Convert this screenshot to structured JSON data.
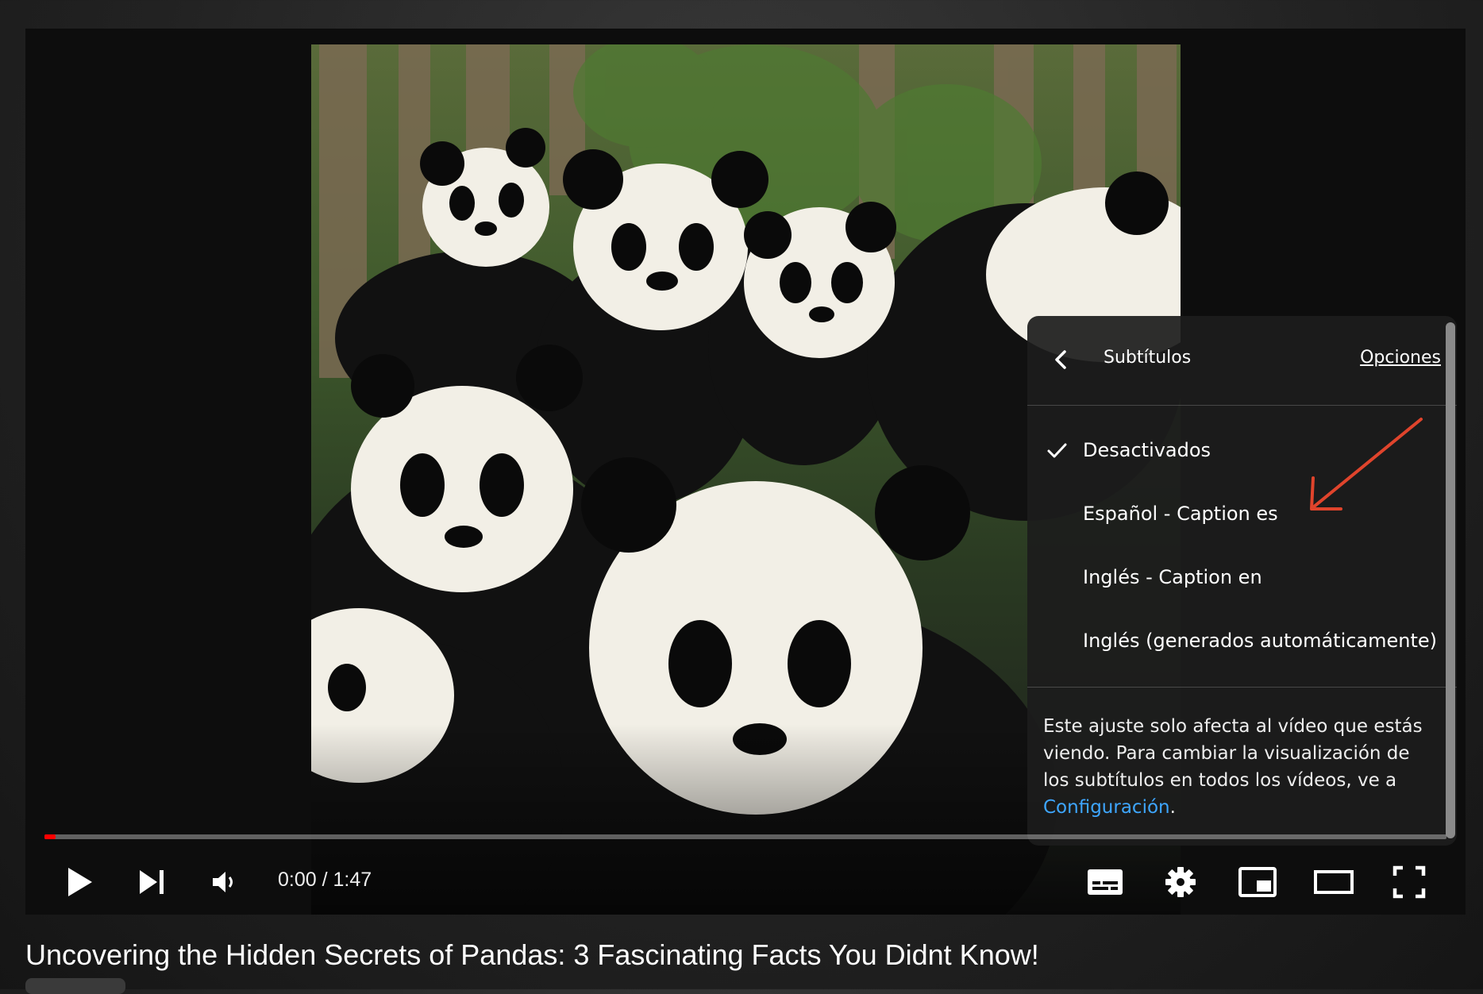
{
  "player": {
    "time_current": "0:00",
    "time_separator": " / ",
    "time_total": "1:47",
    "progress_fraction": 0.008,
    "accent_color": "#ff0000",
    "controls": {
      "play": "play-icon",
      "next": "next-icon",
      "volume": "volume-icon",
      "subtitles": "subtitles-icon",
      "settings": "gear-icon",
      "miniplayer": "miniplayer-icon",
      "theater": "theater-icon",
      "fullscreen": "fullscreen-icon"
    }
  },
  "menu": {
    "title": "Subtítulos",
    "options_link": "Opciones",
    "items": [
      {
        "label": "Desactivados",
        "selected": true
      },
      {
        "label": "Español - Caption es",
        "selected": false
      },
      {
        "label": "Inglés - Caption en",
        "selected": false
      },
      {
        "label": "Inglés (generados automáticamente)",
        "selected": false
      }
    ],
    "note_text": "Este ajuste solo afecta al vídeo que estás viendo. Para cambiar la visualización de los subtítulos en todos los vídeos, ve a ",
    "note_link": "Configuración",
    "note_end": ".",
    "link_color": "#3ea6ff"
  },
  "annotation": {
    "color": "#e0442c"
  },
  "video": {
    "title": "Uncovering the Hidden Secrets of Pandas: 3 Fascinating Facts You Didnt Know!"
  }
}
